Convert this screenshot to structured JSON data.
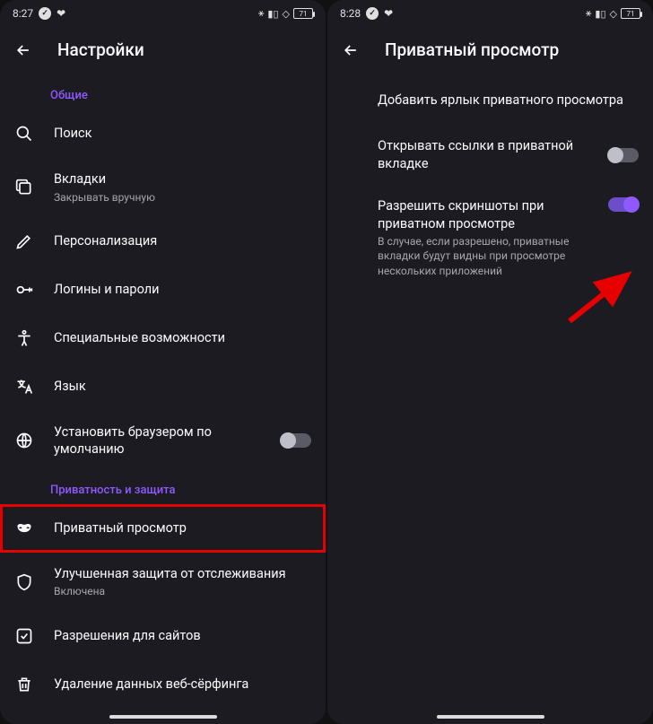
{
  "left": {
    "status": {
      "time": "8:27",
      "battery": "71"
    },
    "appbar_title": "Настройки",
    "section1": "Общие",
    "items1": [
      {
        "title": "Поиск"
      },
      {
        "title": "Вкладки",
        "sub": "Закрывать вручную"
      },
      {
        "title": "Персонализация"
      },
      {
        "title": "Логины и пароли"
      },
      {
        "title": "Специальные возможности"
      },
      {
        "title": "Язык"
      },
      {
        "title": "Установить браузером по умолчанию",
        "toggle": false
      }
    ],
    "section2": "Приватность и защита",
    "items2": [
      {
        "title": "Приватный просмотр",
        "highlight": true
      },
      {
        "title": "Улучшенная защита от отслеживания",
        "sub": "Включена"
      },
      {
        "title": "Разрешения для сайтов"
      },
      {
        "title": "Удаление данных веб-сёрфинга"
      }
    ]
  },
  "right": {
    "status": {
      "time": "8:28",
      "battery": "71"
    },
    "appbar_title": "Приватный просмотр",
    "items": [
      {
        "title": "Добавить ярлык приватного просмотра"
      },
      {
        "title": "Открывать ссылки в приватной вкладке",
        "toggle": false
      },
      {
        "title": "Разрешить скриншоты при приватном просмотре",
        "sub": "В случае, если разрешено, приватные вкладки будут видны при просмотре нескольких приложений",
        "toggle": true
      }
    ]
  }
}
